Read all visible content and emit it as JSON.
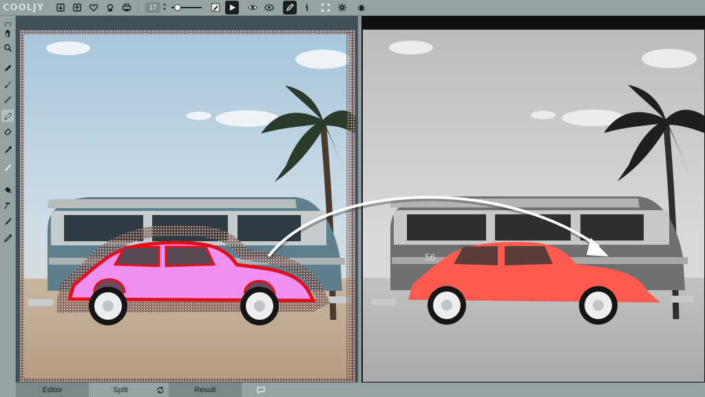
{
  "app": {
    "logo_text": "COOLJY"
  },
  "toolbar": {
    "brush_size": "17",
    "tools": [
      "open-icon",
      "save-icon",
      "export-icon",
      "heart-icon",
      "bulb-icon",
      "print-icon",
      "marker-icon",
      "play-icon",
      "eye-icon",
      "view-icon",
      "pen-icon",
      "info-icon",
      "expand-icon",
      "settings-icon",
      "bug-icon"
    ]
  },
  "sidebar": {
    "tools": [
      "pan-icon",
      "zoom-icon",
      "pencil-icon",
      "brush-icon",
      "dotted-brush-icon",
      "eraser-pencil-icon",
      "eraser-icon",
      "dropper-icon",
      "line-icon",
      "bucket-icon",
      "hammer-icon",
      "color-pick-icon",
      "pipette-icon"
    ]
  },
  "bottom": {
    "tabs": [
      {
        "label": "Editor"
      },
      {
        "label": "Split"
      },
      {
        "label": "Result"
      }
    ]
  },
  "photo": {
    "van_number": "56"
  },
  "colors": {
    "mask_pink": "#f08ff0",
    "result_red": "#ff5a50"
  }
}
